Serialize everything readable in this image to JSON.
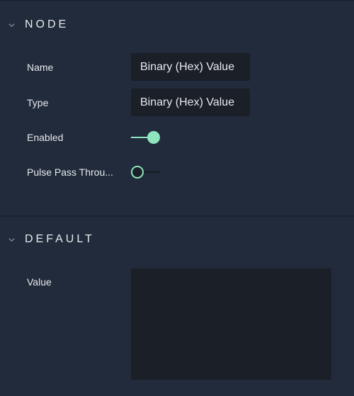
{
  "sections": [
    {
      "title": "NODE",
      "fields": [
        {
          "label": "Name",
          "value": "Binary (Hex) Value"
        },
        {
          "label": "Type",
          "value": "Binary (Hex) Value"
        },
        {
          "label": "Enabled",
          "on": true
        },
        {
          "label": "Pulse Pass Throu...",
          "on": false
        }
      ]
    },
    {
      "title": "DEFAULT",
      "fields": [
        {
          "label": "Value",
          "value": ""
        }
      ]
    }
  ],
  "colors": {
    "accent": "#8ee6c0",
    "background": "#222b3b",
    "input": "#1a1f28"
  }
}
